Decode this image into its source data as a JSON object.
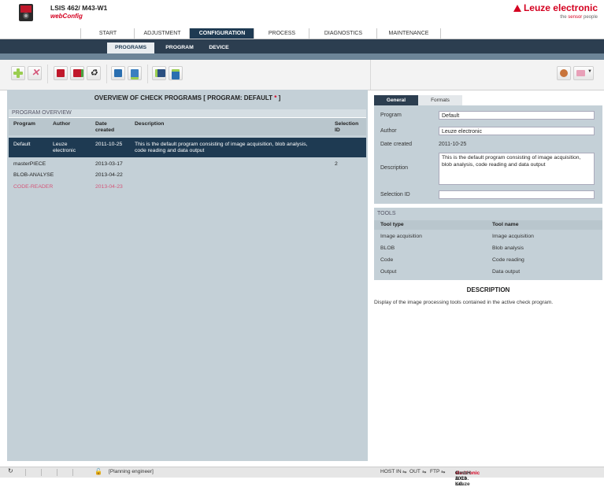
{
  "header": {
    "device_title": "LSIS 462/ M43-W1",
    "app_name": "webConfig",
    "brand": "Leuze electronic",
    "slogan_prefix": "the ",
    "slogan_accent": "sensor",
    "slogan_suffix": " people"
  },
  "main_nav": [
    {
      "label": "START"
    },
    {
      "label": "ADJUSTMENT"
    },
    {
      "label": "CONFIGURATION",
      "active": true
    },
    {
      "label": "PROCESS"
    },
    {
      "label": "DIAGNOSTICS"
    },
    {
      "label": "MAINTENANCE"
    }
  ],
  "sub_nav": [
    {
      "label": "PROGRAMS",
      "active": true
    },
    {
      "label": "PROGRAM"
    },
    {
      "label": "DEVICE"
    }
  ],
  "toolbar": {
    "icons": [
      "add-icon",
      "delete-icon",
      "program-export-icon",
      "program-import-icon",
      "recycle-icon",
      "upload-icon",
      "download-icon",
      "device-upload-icon",
      "device-download-icon",
      "user-icon",
      "language-flag-icon"
    ]
  },
  "overview": {
    "title": "OVERVIEW OF CHECK PROGRAMS   [ PROGRAM: DEFAULT ",
    "title_star": "*",
    "title_end": " ]",
    "section_label": "PROGRAM OVERVIEW",
    "columns": {
      "program": "Program",
      "author": "Author",
      "date_created": "Date created",
      "description": "Description",
      "selection_id": "Selection ID"
    },
    "rows": [
      {
        "program": "Default",
        "author": "Leuze electronic",
        "date": "2011-10-25",
        "description": "This is the default program consisting of image acquisition, blob analysis, code reading and data output",
        "selection_id": ""
      },
      {
        "program": "masterPIECE",
        "author": "",
        "date": "2013-03-17",
        "description": "",
        "selection_id": "2"
      },
      {
        "program": "BLOB-ANALYSE",
        "author": "",
        "date": "2013-04-22",
        "description": "",
        "selection_id": ""
      },
      {
        "program": "CODE-READER",
        "author": "",
        "date": "2013-04-23",
        "description": "",
        "selection_id": ""
      }
    ]
  },
  "details": {
    "tabs": [
      "General",
      "Formats"
    ],
    "labels": {
      "program": "Program",
      "author": "Author",
      "date_created": "Date created",
      "description": "Description",
      "selection_id": "Selection ID"
    },
    "values": {
      "program": "Default",
      "author": "Leuze electronic",
      "date_created": "2011-10-25",
      "description": "This is the default program consisting of image acquisition, blob analysis, code reading and data output",
      "selection_id": ""
    }
  },
  "tools": {
    "label": "TOOLS",
    "col_type": "Tool type",
    "col_name": "Tool name",
    "rows": [
      {
        "type": "Image acquisition",
        "name": "Image acquisition"
      },
      {
        "type": "BLOB",
        "name": "Blob analysis"
      },
      {
        "type": "Code",
        "name": "Code reading"
      },
      {
        "type": "Output",
        "name": "Data output"
      }
    ]
  },
  "description_panel": {
    "title": "DESCRIPTION",
    "text": "Display of the image processing tools contained in the active check program."
  },
  "status": {
    "user": "[Planning engineer]",
    "host_in": "HOST IN",
    "out": "OUT",
    "ftp": "FTP",
    "copyright_pre": "© 2013 Leuze ",
    "copyright_accent": "electronic",
    "copyright_post": " GmbH & Co. KG"
  },
  "colors": {
    "accent": "#d40020",
    "nav_dark": "#1e3a52",
    "panel": "#c4d0d7",
    "highlight_row": "#1e3a52",
    "inactive_program": "#d4577a"
  }
}
